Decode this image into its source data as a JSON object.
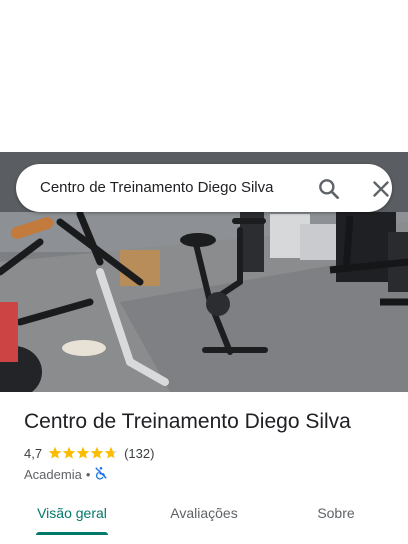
{
  "search": {
    "query": "Centro de Treinamento Diego Silva"
  },
  "photo": {
    "subject": "gym-interior-exercise-bikes"
  },
  "place": {
    "name": "Centro de Treinamento Diego Silva",
    "rating": "4,7",
    "rating_stars": 4.7,
    "review_count": "(132)",
    "category": "Academia",
    "separator": "•",
    "accessibility_icon": "no-wheelchair-access-icon"
  },
  "tabs": [
    {
      "label": "Visão geral",
      "active": true
    },
    {
      "label": "Avaliações",
      "active": false
    },
    {
      "label": "Sobre",
      "active": false
    }
  ],
  "colors": {
    "accent": "#00796b",
    "star": "#fbbc04",
    "access_icon": "#1a73e8"
  }
}
